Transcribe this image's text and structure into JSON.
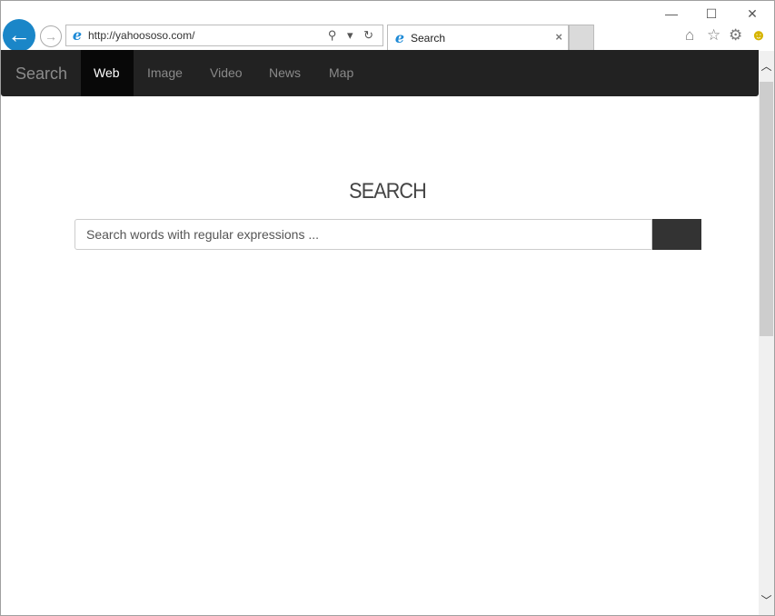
{
  "browser": {
    "url": "http://yahoososo.com/",
    "tab_title": "Search",
    "tab_close": "×",
    "controls": {
      "minimize": "—",
      "maximize": "☐",
      "close": "✕"
    },
    "address_controls": "⚲ ▾ ↻",
    "icons": [
      "back-arrow-icon",
      "forward-arrow-icon",
      "ie-logo-icon",
      "home-icon",
      "star-icon",
      "gear-icon",
      "smiley-icon"
    ]
  },
  "navbar": {
    "brand": "Search",
    "items": [
      {
        "label": "Web",
        "active": true
      },
      {
        "label": "Image"
      },
      {
        "label": "Video"
      },
      {
        "label": "News"
      },
      {
        "label": "Map"
      }
    ]
  },
  "main": {
    "title": "SEARCH",
    "search_placeholder": "Search words with regular expressions ...",
    "search_value": ""
  },
  "colors": {
    "navbar": "#222222",
    "active": "#080808",
    "button": "#333333",
    "back_button": "#1a86c8"
  }
}
